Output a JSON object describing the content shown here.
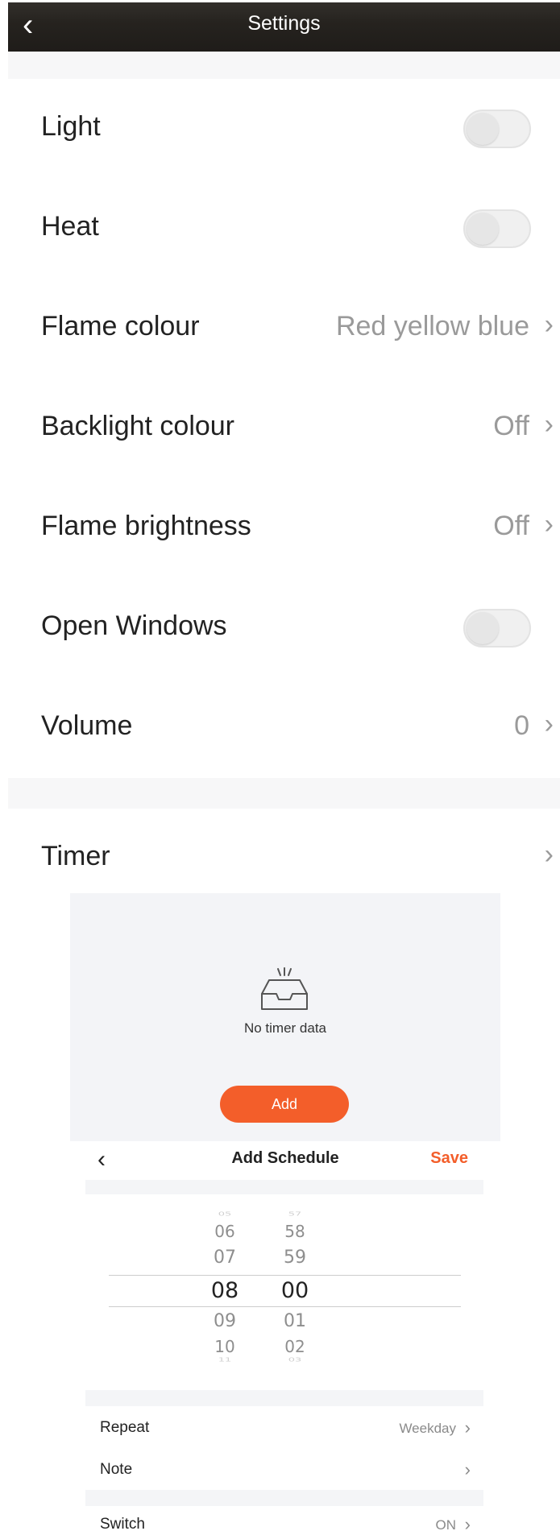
{
  "header": {
    "title": "Settings",
    "back_icon": "chevron-left-icon"
  },
  "settings": [
    {
      "label": "Light",
      "type": "toggle",
      "on": false
    },
    {
      "label": "Heat",
      "type": "toggle",
      "on": false
    },
    {
      "label": "Flame colour",
      "type": "select",
      "value": "Red yellow blue"
    },
    {
      "label": "Backlight colour",
      "type": "select",
      "value": "Off"
    },
    {
      "label": "Flame brightness",
      "type": "select",
      "value": "Off"
    },
    {
      "label": "Open Windows",
      "type": "toggle",
      "on": false
    },
    {
      "label": "Volume",
      "type": "select",
      "value": "0"
    }
  ],
  "timer": {
    "label": "Timer",
    "empty_text": "No timer data",
    "empty_icon": "empty-inbox-icon",
    "add_label": "Add"
  },
  "schedule": {
    "title": "Add Schedule",
    "save_label": "Save",
    "hours": [
      "05",
      "06",
      "07",
      "08",
      "09",
      "10",
      "11"
    ],
    "minutes": [
      "57",
      "58",
      "59",
      "00",
      "01",
      "02",
      "03"
    ],
    "selected_hour": "08",
    "selected_minute": "00",
    "rows": [
      {
        "label": "Repeat",
        "value": "Weekday"
      },
      {
        "label": "Note",
        "value": ""
      },
      {
        "label": "Switch",
        "value": "ON"
      }
    ]
  },
  "colors": {
    "accent": "#f35e2a",
    "toggle_off": "#f0f0f0",
    "muted_text": "#9a9a9a"
  }
}
